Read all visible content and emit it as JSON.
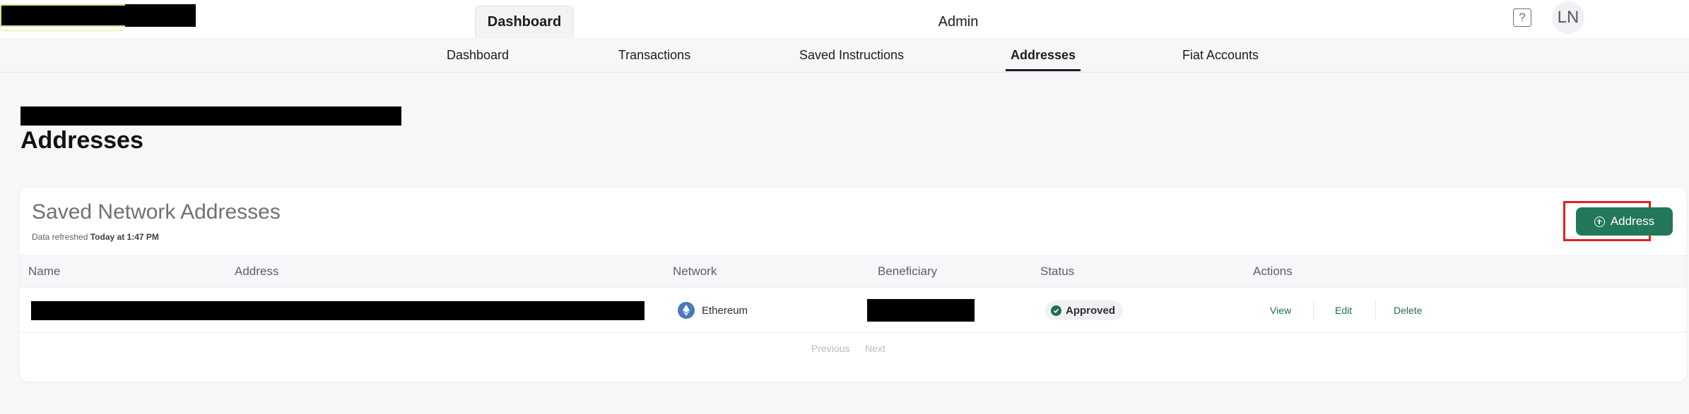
{
  "header": {
    "tabs": [
      {
        "label": "Dashboard",
        "active": true
      },
      {
        "label": "Admin",
        "active": false
      }
    ],
    "help_glyph": "?",
    "avatar_initials": "LN"
  },
  "subnav": {
    "items": [
      {
        "label": "Dashboard",
        "active": false
      },
      {
        "label": "Transactions",
        "active": false
      },
      {
        "label": "Saved Instructions",
        "active": false
      },
      {
        "label": "Addresses",
        "active": true
      },
      {
        "label": "Fiat Accounts",
        "active": false
      }
    ]
  },
  "page": {
    "title": "Addresses"
  },
  "card": {
    "title": "Saved Network Addresses",
    "refresh_label": "Data refreshed",
    "refresh_time": "Today at 1:47 PM",
    "add_button_label": "Address",
    "add_button_icon": "plus-circle-icon"
  },
  "table": {
    "columns": [
      "Name",
      "Address",
      "Network",
      "Beneficiary",
      "Status",
      "Actions"
    ],
    "rows": [
      {
        "network": "Ethereum",
        "network_icon": "ethereum-icon",
        "status": "Approved",
        "status_icon": "check-circle-icon",
        "actions": [
          "View",
          "Edit",
          "Delete"
        ]
      }
    ],
    "pagination": {
      "previous": "Previous",
      "next": "Next"
    }
  },
  "colors": {
    "accent_green": "#23775a",
    "highlight_red": "#e2231a",
    "ethereum_blue": "#4a7ab8"
  }
}
